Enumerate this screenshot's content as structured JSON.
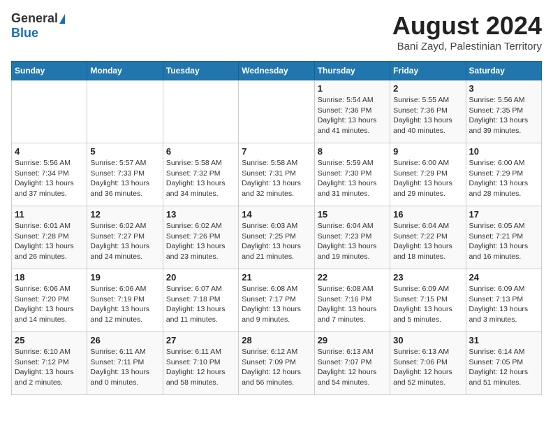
{
  "header": {
    "logo_general": "General",
    "logo_blue": "Blue",
    "month_year": "August 2024",
    "location": "Bani Zayd, Palestinian Territory"
  },
  "calendar": {
    "days_of_week": [
      "Sunday",
      "Monday",
      "Tuesday",
      "Wednesday",
      "Thursday",
      "Friday",
      "Saturday"
    ],
    "weeks": [
      [
        {
          "day": "",
          "info": ""
        },
        {
          "day": "",
          "info": ""
        },
        {
          "day": "",
          "info": ""
        },
        {
          "day": "",
          "info": ""
        },
        {
          "day": "1",
          "info": "Sunrise: 5:54 AM\nSunset: 7:36 PM\nDaylight: 13 hours\nand 41 minutes."
        },
        {
          "day": "2",
          "info": "Sunrise: 5:55 AM\nSunset: 7:36 PM\nDaylight: 13 hours\nand 40 minutes."
        },
        {
          "day": "3",
          "info": "Sunrise: 5:56 AM\nSunset: 7:35 PM\nDaylight: 13 hours\nand 39 minutes."
        }
      ],
      [
        {
          "day": "4",
          "info": "Sunrise: 5:56 AM\nSunset: 7:34 PM\nDaylight: 13 hours\nand 37 minutes."
        },
        {
          "day": "5",
          "info": "Sunrise: 5:57 AM\nSunset: 7:33 PM\nDaylight: 13 hours\nand 36 minutes."
        },
        {
          "day": "6",
          "info": "Sunrise: 5:58 AM\nSunset: 7:32 PM\nDaylight: 13 hours\nand 34 minutes."
        },
        {
          "day": "7",
          "info": "Sunrise: 5:58 AM\nSunset: 7:31 PM\nDaylight: 13 hours\nand 32 minutes."
        },
        {
          "day": "8",
          "info": "Sunrise: 5:59 AM\nSunset: 7:30 PM\nDaylight: 13 hours\nand 31 minutes."
        },
        {
          "day": "9",
          "info": "Sunrise: 6:00 AM\nSunset: 7:29 PM\nDaylight: 13 hours\nand 29 minutes."
        },
        {
          "day": "10",
          "info": "Sunrise: 6:00 AM\nSunset: 7:29 PM\nDaylight: 13 hours\nand 28 minutes."
        }
      ],
      [
        {
          "day": "11",
          "info": "Sunrise: 6:01 AM\nSunset: 7:28 PM\nDaylight: 13 hours\nand 26 minutes."
        },
        {
          "day": "12",
          "info": "Sunrise: 6:02 AM\nSunset: 7:27 PM\nDaylight: 13 hours\nand 24 minutes."
        },
        {
          "day": "13",
          "info": "Sunrise: 6:02 AM\nSunset: 7:26 PM\nDaylight: 13 hours\nand 23 minutes."
        },
        {
          "day": "14",
          "info": "Sunrise: 6:03 AM\nSunset: 7:25 PM\nDaylight: 13 hours\nand 21 minutes."
        },
        {
          "day": "15",
          "info": "Sunrise: 6:04 AM\nSunset: 7:23 PM\nDaylight: 13 hours\nand 19 minutes."
        },
        {
          "day": "16",
          "info": "Sunrise: 6:04 AM\nSunset: 7:22 PM\nDaylight: 13 hours\nand 18 minutes."
        },
        {
          "day": "17",
          "info": "Sunrise: 6:05 AM\nSunset: 7:21 PM\nDaylight: 13 hours\nand 16 minutes."
        }
      ],
      [
        {
          "day": "18",
          "info": "Sunrise: 6:06 AM\nSunset: 7:20 PM\nDaylight: 13 hours\nand 14 minutes."
        },
        {
          "day": "19",
          "info": "Sunrise: 6:06 AM\nSunset: 7:19 PM\nDaylight: 13 hours\nand 12 minutes."
        },
        {
          "day": "20",
          "info": "Sunrise: 6:07 AM\nSunset: 7:18 PM\nDaylight: 13 hours\nand 11 minutes."
        },
        {
          "day": "21",
          "info": "Sunrise: 6:08 AM\nSunset: 7:17 PM\nDaylight: 13 hours\nand 9 minutes."
        },
        {
          "day": "22",
          "info": "Sunrise: 6:08 AM\nSunset: 7:16 PM\nDaylight: 13 hours\nand 7 minutes."
        },
        {
          "day": "23",
          "info": "Sunrise: 6:09 AM\nSunset: 7:15 PM\nDaylight: 13 hours\nand 5 minutes."
        },
        {
          "day": "24",
          "info": "Sunrise: 6:09 AM\nSunset: 7:13 PM\nDaylight: 13 hours\nand 3 minutes."
        }
      ],
      [
        {
          "day": "25",
          "info": "Sunrise: 6:10 AM\nSunset: 7:12 PM\nDaylight: 13 hours\nand 2 minutes."
        },
        {
          "day": "26",
          "info": "Sunrise: 6:11 AM\nSunset: 7:11 PM\nDaylight: 13 hours\nand 0 minutes."
        },
        {
          "day": "27",
          "info": "Sunrise: 6:11 AM\nSunset: 7:10 PM\nDaylight: 12 hours\nand 58 minutes."
        },
        {
          "day": "28",
          "info": "Sunrise: 6:12 AM\nSunset: 7:09 PM\nDaylight: 12 hours\nand 56 minutes."
        },
        {
          "day": "29",
          "info": "Sunrise: 6:13 AM\nSunset: 7:07 PM\nDaylight: 12 hours\nand 54 minutes."
        },
        {
          "day": "30",
          "info": "Sunrise: 6:13 AM\nSunset: 7:06 PM\nDaylight: 12 hours\nand 52 minutes."
        },
        {
          "day": "31",
          "info": "Sunrise: 6:14 AM\nSunset: 7:05 PM\nDaylight: 12 hours\nand 51 minutes."
        }
      ]
    ]
  }
}
